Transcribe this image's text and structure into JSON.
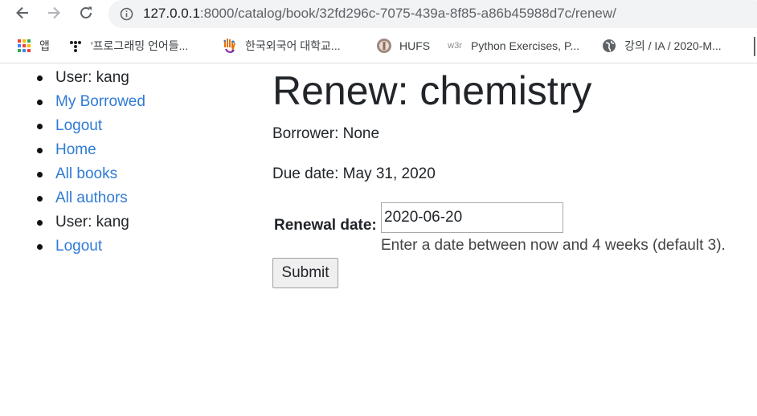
{
  "browser": {
    "url_host": "127.0.0.1",
    "url_rest": ":8000/catalog/book/32fd296c-7075-439a-8f85-a86b45988d7c/renew/",
    "bookmarks": [
      {
        "label": "앱",
        "icon": "apps-grid-icon"
      },
      {
        "label": "'프로그래밍 언어들...",
        "icon": "bookmark-dots-icon"
      },
      {
        "label": "한국외국어 대학교...",
        "icon": "hand-logo-icon"
      },
      {
        "label": "HUFS",
        "icon": "hufs-logo-icon"
      },
      {
        "label": "Python Exercises, P...",
        "icon": "w3r-logo-icon"
      },
      {
        "label": "강의 / IA / 2020-M...",
        "icon": "globe-icon"
      }
    ]
  },
  "sidebar": {
    "items": [
      {
        "label": "User: kang",
        "link": false
      },
      {
        "label": "My Borrowed",
        "link": true
      },
      {
        "label": "Logout",
        "link": true
      },
      {
        "label": "Home",
        "link": true
      },
      {
        "label": "All books",
        "link": true
      },
      {
        "label": "All authors",
        "link": true
      },
      {
        "label": "User: kang",
        "link": false
      },
      {
        "label": "Logout",
        "link": true
      }
    ]
  },
  "main": {
    "title": "Renew: chemistry",
    "borrower": "Borrower: None",
    "due_date": "Due date: May 31, 2020",
    "form": {
      "renewal_label": "Renewal date:",
      "renewal_value": "2020-06-20",
      "help_text": "Enter a date between now and 4 weeks (default 3).",
      "submit_label": "Submit"
    }
  },
  "colors": {
    "link": "#2f7bd5",
    "text": "#212529",
    "omnibox_bg": "#f1f3f4"
  }
}
